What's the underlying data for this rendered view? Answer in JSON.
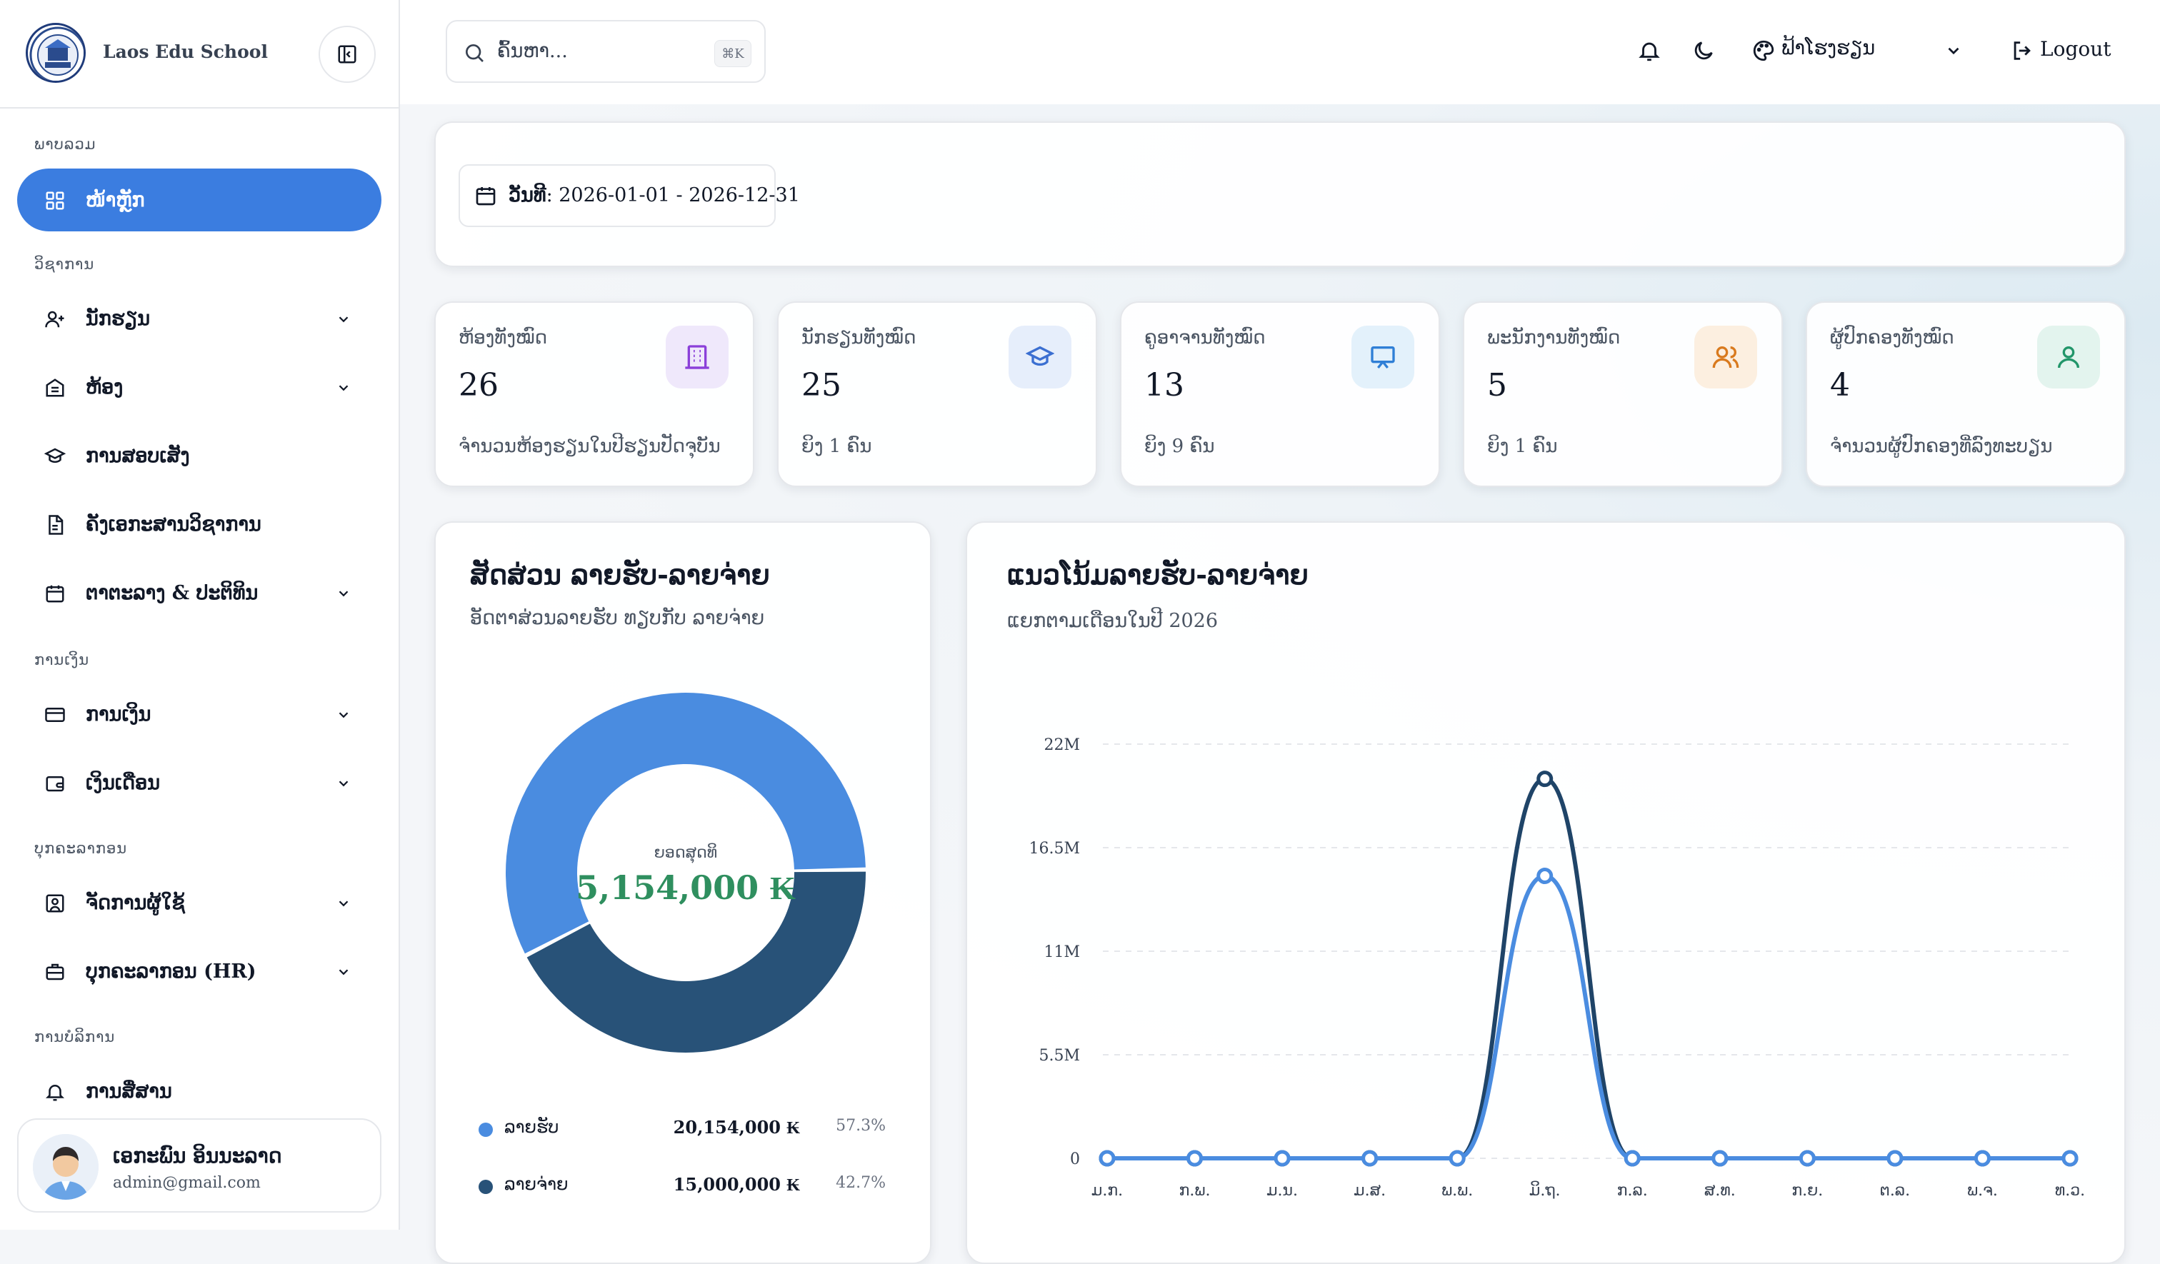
{
  "app": {
    "name": "Laos Edu School"
  },
  "sidebar": {
    "sections": [
      {
        "label": "ພາບລວມ"
      },
      {
        "label": "ວິຊາການ"
      },
      {
        "label": "ການເງິນ"
      },
      {
        "label": "ບຸກຄະລາກອນ"
      },
      {
        "label": "ການບໍລິການ"
      }
    ],
    "items": [
      {
        "label": "ໜ້າຫຼັກ",
        "icon": "grid-icon",
        "active": true
      },
      {
        "label": "ນັກຮຽນ",
        "icon": "user-plus-icon"
      },
      {
        "label": "ຫ້ອງ",
        "icon": "building-icon"
      },
      {
        "label": "ການສອບເສັງ",
        "icon": "graduation-cap-icon"
      },
      {
        "label": "ຄັງເອກະສານວິຊາການ",
        "icon": "file-icon"
      },
      {
        "label": "ຕາຕະລາງ & ປະຕິທິນ",
        "icon": "calendar-icon"
      },
      {
        "label": "ການເງິນ",
        "icon": "credit-card-icon"
      },
      {
        "label": "ເງິນເດືອນ",
        "icon": "wallet-icon"
      },
      {
        "label": "ຈັດການຜູ້ໃຊ້",
        "icon": "user-square-icon"
      },
      {
        "label": "ບຸກຄະລາກອນ (HR)",
        "icon": "briefcase-icon"
      },
      {
        "label": "ການສື່ສານ",
        "icon": "bell-ring-icon"
      }
    ],
    "user": {
      "name": "ເອກະພົນ ອິນນະລາດ",
      "email": "admin@gmail.com"
    }
  },
  "topbar": {
    "search_placeholder": "ຄົ້ນຫາ...",
    "search_shortcut": "⌘K",
    "theme_label": "ຟ້າໂຮງຮຽນ",
    "logout_label": "Logout"
  },
  "filter": {
    "date_label": "ວັນທີ",
    "date_range": "2026-01-01 - 2026-12-31"
  },
  "stats": [
    {
      "label": "ຫ້ອງທັງໝົດ",
      "value": "26",
      "sub": "ຈຳນວນຫ້ອງຮຽນໃນປີຮຽນປັດຈຸບັນ",
      "icon": "building-icon",
      "bg": "#efe8fb",
      "fg": "#8b3fd9"
    },
    {
      "label": "ນັກຮຽນທັງໝົດ",
      "value": "25",
      "sub": "ຍິງ 1 ຄົນ",
      "icon": "graduation-cap-icon",
      "bg": "#e6eefb",
      "fg": "#3b6fd1"
    },
    {
      "label": "ຄູອາຈານທັງໝົດ",
      "value": "13",
      "sub": "ຍິງ 9 ຄົນ",
      "icon": "presentation-icon",
      "bg": "#e3f1fb",
      "fg": "#2f7fd6"
    },
    {
      "label": "ພະນັກງານທັງໝົດ",
      "value": "5",
      "sub": "ຍິງ 1 ຄົນ",
      "icon": "users-icon",
      "bg": "#fcefe0",
      "fg": "#d97a1e"
    },
    {
      "label": "ຜູ້ປົກຄອງທັງໝົດ",
      "value": "4",
      "sub": "ຈຳນວນຜູ້ປົກຄອງທີ່ລົງທະບຽນ",
      "icon": "user-icon",
      "bg": "#e3f4ee",
      "fg": "#22966a"
    }
  ],
  "donut": {
    "title": "ສັດສ່ວນ ລາຍຮັບ-ລາຍຈ່າຍ",
    "subtitle": "ອັດຕາສ່ວນລາຍຮັບ ທຽບກັບ ລາຍຈ່າຍ",
    "center_label": "ຍອດສຸດທິ",
    "center_value": "5,154,000 ₭",
    "legend": [
      {
        "name": "ລາຍຮັບ",
        "amount": "20,154,000 ₭",
        "pct": "57.3%",
        "color": "#4a8ce0"
      },
      {
        "name": "ລາຍຈ່າຍ",
        "amount": "15,000,000 ₭",
        "pct": "42.7%",
        "color": "#285278"
      }
    ]
  },
  "trend": {
    "title": "ແນວໂນ້ມລາຍຮັບ-ລາຍຈ່າຍ",
    "subtitle": "ແຍກຕາມເດືອນໃນປີ 2026"
  },
  "chart_data": [
    {
      "type": "pie",
      "title": "ສັດສ່ວນ ລາຍຮັບ-ລາຍຈ່າຍ",
      "categories": [
        "ລາຍຮັບ",
        "ລາຍຈ່າຍ"
      ],
      "values": [
        20154000,
        15000000
      ],
      "colors": [
        "#4a8ce0",
        "#285278"
      ]
    },
    {
      "type": "line",
      "title": "ແນວໂນ້ມລາຍຮັບ-ລາຍຈ່າຍ",
      "x": [
        "ມ.ກ.",
        "ກ.ພ.",
        "ມ.ນ.",
        "ມ.ສ.",
        "ພ.ພ.",
        "ມິ.ຖ.",
        "ກ.ລ.",
        "ສ.ທ.",
        "ກ.ຍ.",
        "ຕ.ລ.",
        "ພ.ຈ.",
        "ທ.ວ."
      ],
      "yticks": [
        "0",
        "5.5M",
        "11M",
        "16.5M",
        "22M"
      ],
      "ylim": [
        0,
        22000000
      ],
      "grid": true,
      "series": [
        {
          "values": [
            0,
            0,
            0,
            0,
            0,
            20154000,
            0,
            0,
            0,
            0,
            0,
            0
          ],
          "color": "#1f4468"
        },
        {
          "values": [
            0,
            0,
            0,
            0,
            0,
            15000000,
            0,
            0,
            0,
            0,
            0,
            0
          ],
          "color": "#4a8ce0"
        }
      ]
    }
  ]
}
